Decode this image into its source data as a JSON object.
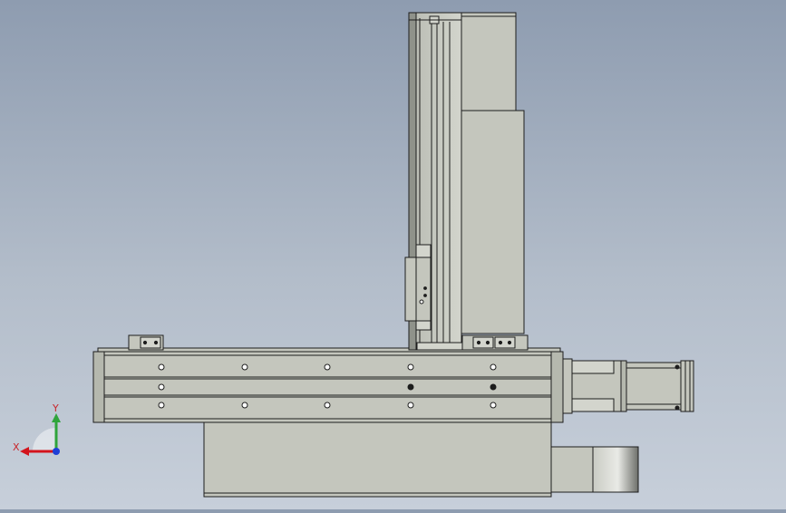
{
  "colors": {
    "part_fill": "#c4c6bd",
    "part_fill_dark": "#b5b8ae",
    "outline": "#1d1d1d",
    "x_axis": "#d3141c",
    "y_axis": "#2fa43b",
    "z_axis": "#1f3fd6",
    "axis_label": "#c8262b"
  },
  "triad": {
    "x_label": "X",
    "y_label": "Y"
  }
}
